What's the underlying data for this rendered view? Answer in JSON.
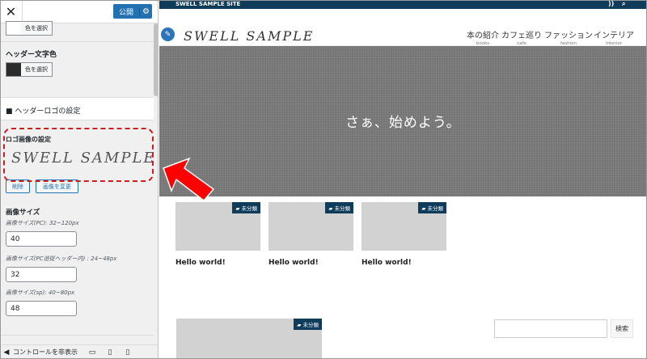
{
  "customizer": {
    "close_label": "✕",
    "publish_label": "公開",
    "select_color_label": "色を選択",
    "header_text_color_label": "ヘッダー文字色",
    "header_text_color": "#2b2b2b",
    "header_logo_section": "■ ヘッダーロゴの設定",
    "logo_image_label": "ロゴ画像の設定",
    "logo_preview_text": "SWELL SAMPLE",
    "remove_label": "削除",
    "change_image_label": "画像を変更",
    "image_size_label": "画像サイズ",
    "pc_size_hint": "画像サイズ(PC): 32~120px",
    "pc_size_value": "40",
    "pc_follow_hint": "画像サイズ(PC追従ヘッダー内) : 24~48px",
    "pc_follow_value": "32",
    "sp_size_hint": "画像サイズ(sp): 40~80px",
    "sp_size_value": "48",
    "hide_controls_label": "コントロールを非表示"
  },
  "site": {
    "topbar_title": "SWELL SAMPLE SITE",
    "logo": "SWELL SAMPLE",
    "nav": [
      {
        "jp": "本の紹介",
        "en": "books"
      },
      {
        "jp": "カフェ巡り",
        "en": "cafe"
      },
      {
        "jp": "ファッション",
        "en": "fashion"
      },
      {
        "jp": "インテリア",
        "en": "interior"
      }
    ],
    "hero_text": "さぁ、始めよう。",
    "category_badge": "未分類",
    "posts": [
      {
        "title": "Hello world!"
      },
      {
        "title": "Hello world!"
      },
      {
        "title": "Hello world!"
      }
    ],
    "search_button": "検索"
  },
  "colors": {
    "accent": "#2271b1",
    "topbar": "#0f3c5a",
    "highlight": "#c9211e",
    "arrow": "#ff0000"
  }
}
